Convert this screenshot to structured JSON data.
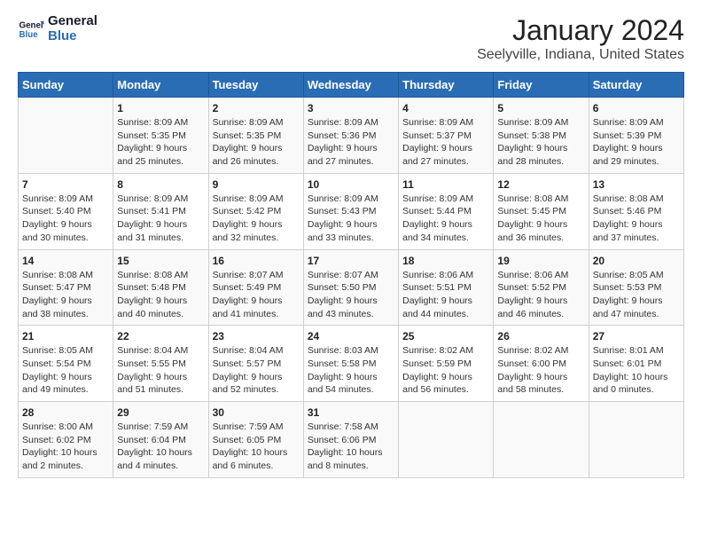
{
  "header": {
    "logo_line1": "General",
    "logo_line2": "Blue",
    "title": "January 2024",
    "subtitle": "Seelyville, Indiana, United States"
  },
  "columns": [
    "Sunday",
    "Monday",
    "Tuesday",
    "Wednesday",
    "Thursday",
    "Friday",
    "Saturday"
  ],
  "weeks": [
    [
      {
        "day": "",
        "info": ""
      },
      {
        "day": "1",
        "info": "Sunrise: 8:09 AM\nSunset: 5:35 PM\nDaylight: 9 hours\nand 25 minutes."
      },
      {
        "day": "2",
        "info": "Sunrise: 8:09 AM\nSunset: 5:35 PM\nDaylight: 9 hours\nand 26 minutes."
      },
      {
        "day": "3",
        "info": "Sunrise: 8:09 AM\nSunset: 5:36 PM\nDaylight: 9 hours\nand 27 minutes."
      },
      {
        "day": "4",
        "info": "Sunrise: 8:09 AM\nSunset: 5:37 PM\nDaylight: 9 hours\nand 27 minutes."
      },
      {
        "day": "5",
        "info": "Sunrise: 8:09 AM\nSunset: 5:38 PM\nDaylight: 9 hours\nand 28 minutes."
      },
      {
        "day": "6",
        "info": "Sunrise: 8:09 AM\nSunset: 5:39 PM\nDaylight: 9 hours\nand 29 minutes."
      }
    ],
    [
      {
        "day": "7",
        "info": "Sunrise: 8:09 AM\nSunset: 5:40 PM\nDaylight: 9 hours\nand 30 minutes."
      },
      {
        "day": "8",
        "info": "Sunrise: 8:09 AM\nSunset: 5:41 PM\nDaylight: 9 hours\nand 31 minutes."
      },
      {
        "day": "9",
        "info": "Sunrise: 8:09 AM\nSunset: 5:42 PM\nDaylight: 9 hours\nand 32 minutes."
      },
      {
        "day": "10",
        "info": "Sunrise: 8:09 AM\nSunset: 5:43 PM\nDaylight: 9 hours\nand 33 minutes."
      },
      {
        "day": "11",
        "info": "Sunrise: 8:09 AM\nSunset: 5:44 PM\nDaylight: 9 hours\nand 34 minutes."
      },
      {
        "day": "12",
        "info": "Sunrise: 8:08 AM\nSunset: 5:45 PM\nDaylight: 9 hours\nand 36 minutes."
      },
      {
        "day": "13",
        "info": "Sunrise: 8:08 AM\nSunset: 5:46 PM\nDaylight: 9 hours\nand 37 minutes."
      }
    ],
    [
      {
        "day": "14",
        "info": "Sunrise: 8:08 AM\nSunset: 5:47 PM\nDaylight: 9 hours\nand 38 minutes."
      },
      {
        "day": "15",
        "info": "Sunrise: 8:08 AM\nSunset: 5:48 PM\nDaylight: 9 hours\nand 40 minutes."
      },
      {
        "day": "16",
        "info": "Sunrise: 8:07 AM\nSunset: 5:49 PM\nDaylight: 9 hours\nand 41 minutes."
      },
      {
        "day": "17",
        "info": "Sunrise: 8:07 AM\nSunset: 5:50 PM\nDaylight: 9 hours\nand 43 minutes."
      },
      {
        "day": "18",
        "info": "Sunrise: 8:06 AM\nSunset: 5:51 PM\nDaylight: 9 hours\nand 44 minutes."
      },
      {
        "day": "19",
        "info": "Sunrise: 8:06 AM\nSunset: 5:52 PM\nDaylight: 9 hours\nand 46 minutes."
      },
      {
        "day": "20",
        "info": "Sunrise: 8:05 AM\nSunset: 5:53 PM\nDaylight: 9 hours\nand 47 minutes."
      }
    ],
    [
      {
        "day": "21",
        "info": "Sunrise: 8:05 AM\nSunset: 5:54 PM\nDaylight: 9 hours\nand 49 minutes."
      },
      {
        "day": "22",
        "info": "Sunrise: 8:04 AM\nSunset: 5:55 PM\nDaylight: 9 hours\nand 51 minutes."
      },
      {
        "day": "23",
        "info": "Sunrise: 8:04 AM\nSunset: 5:57 PM\nDaylight: 9 hours\nand 52 minutes."
      },
      {
        "day": "24",
        "info": "Sunrise: 8:03 AM\nSunset: 5:58 PM\nDaylight: 9 hours\nand 54 minutes."
      },
      {
        "day": "25",
        "info": "Sunrise: 8:02 AM\nSunset: 5:59 PM\nDaylight: 9 hours\nand 56 minutes."
      },
      {
        "day": "26",
        "info": "Sunrise: 8:02 AM\nSunset: 6:00 PM\nDaylight: 9 hours\nand 58 minutes."
      },
      {
        "day": "27",
        "info": "Sunrise: 8:01 AM\nSunset: 6:01 PM\nDaylight: 10 hours\nand 0 minutes."
      }
    ],
    [
      {
        "day": "28",
        "info": "Sunrise: 8:00 AM\nSunset: 6:02 PM\nDaylight: 10 hours\nand 2 minutes."
      },
      {
        "day": "29",
        "info": "Sunrise: 7:59 AM\nSunset: 6:04 PM\nDaylight: 10 hours\nand 4 minutes."
      },
      {
        "day": "30",
        "info": "Sunrise: 7:59 AM\nSunset: 6:05 PM\nDaylight: 10 hours\nand 6 minutes."
      },
      {
        "day": "31",
        "info": "Sunrise: 7:58 AM\nSunset: 6:06 PM\nDaylight: 10 hours\nand 8 minutes."
      },
      {
        "day": "",
        "info": ""
      },
      {
        "day": "",
        "info": ""
      },
      {
        "day": "",
        "info": ""
      }
    ]
  ]
}
